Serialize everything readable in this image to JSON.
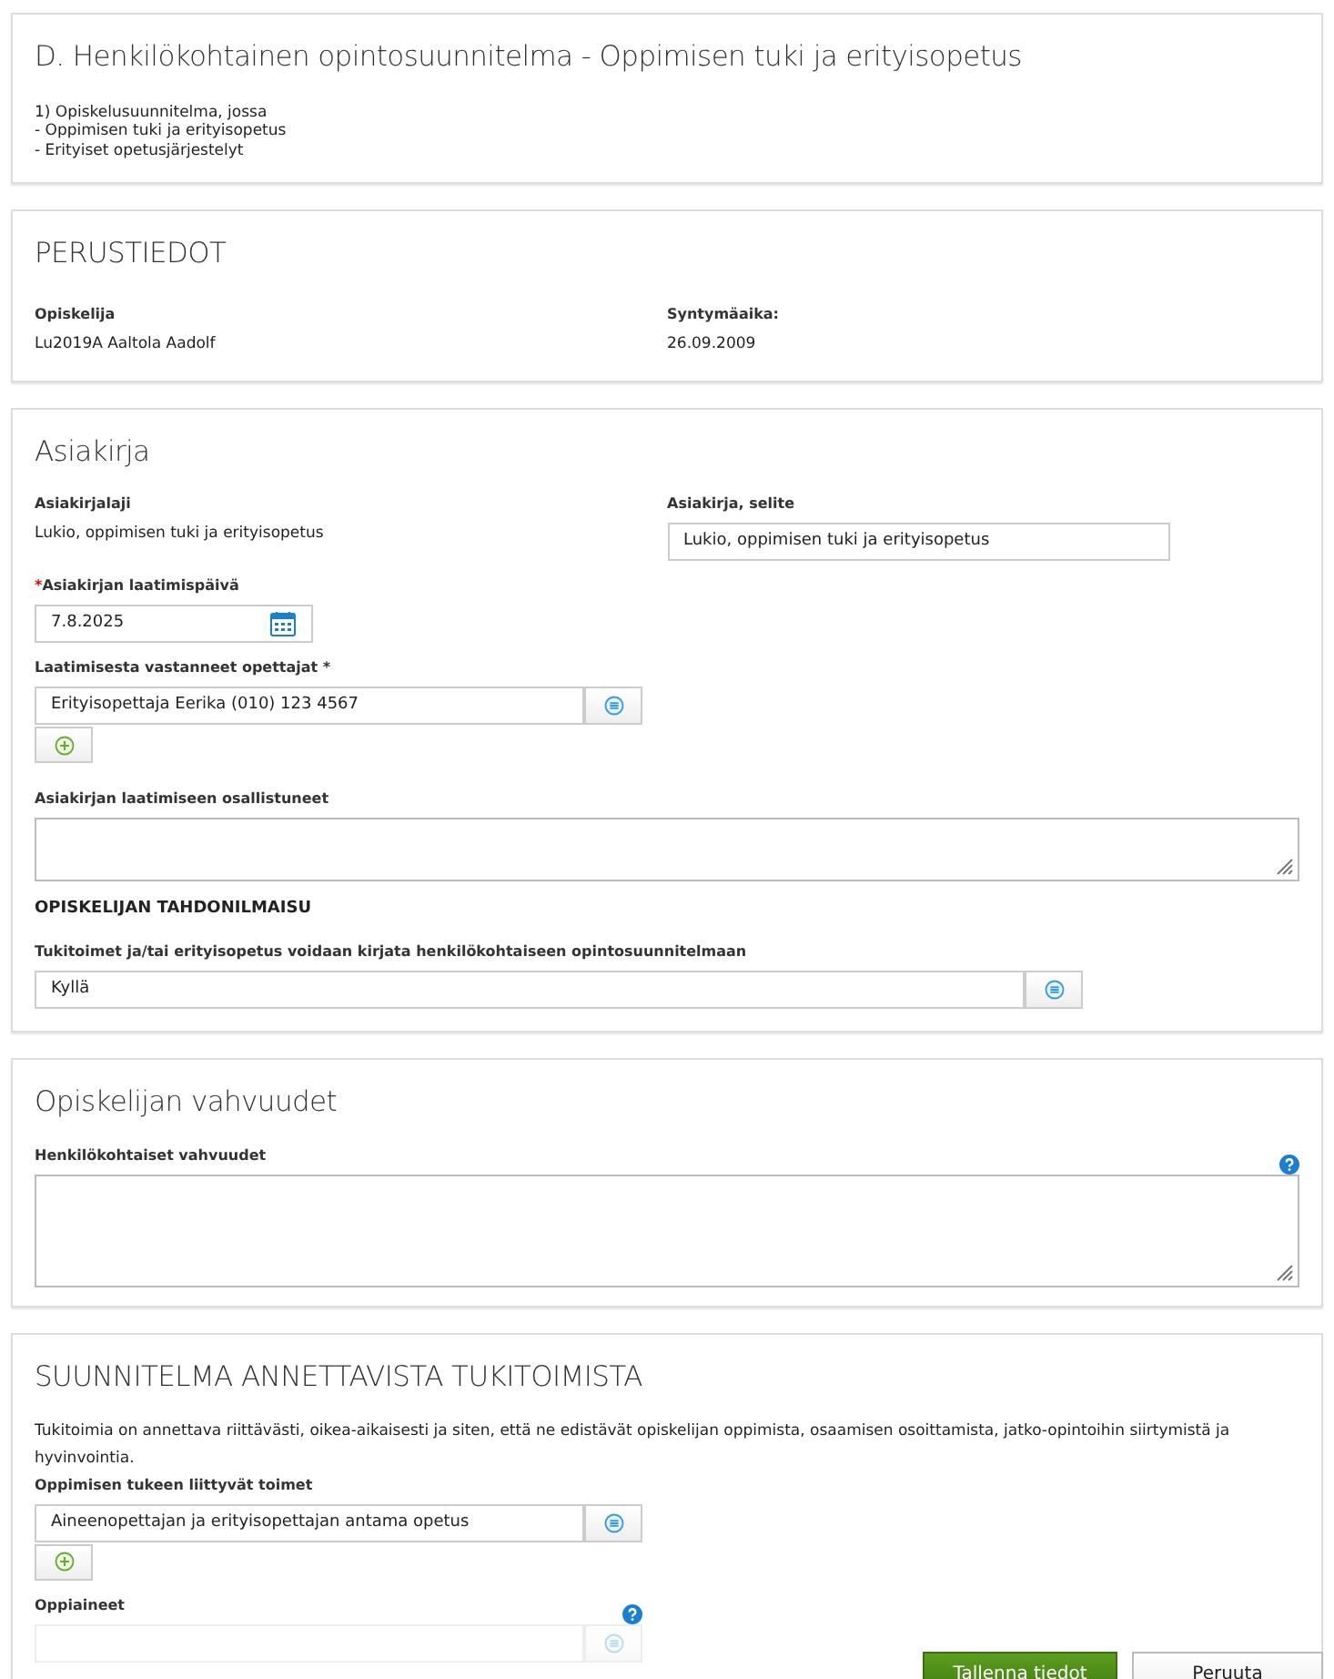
{
  "header": {
    "title": "D. Henkilökohtainen opintosuunnitelma - Oppimisen tuki ja erityisopetus",
    "lines": [
      "1) Opiskelusuunnitelma, jossa",
      "- Oppimisen tuki ja erityisopetus",
      "- Erityiset opetusjärjestelyt"
    ]
  },
  "basic_info": {
    "title": "PERUSTIEDOT",
    "fields": [
      {
        "label": "Opiskelija",
        "value": "Lu2019A Aaltola Aadolf"
      },
      {
        "label": "Syntymäaika:",
        "value": "26.09.2009"
      }
    ]
  },
  "document": {
    "title": "Asiakirja",
    "type_label": "Asiakirjalaji",
    "type_value": "Lukio, oppimisen tuki ja erityisopetus",
    "description_label": "Asiakirja, selite",
    "description_value": "Lukio, oppimisen tuki ja erityisopetus",
    "date_required_mark": "*",
    "date_label": "Asiakirjan laatimispäivä",
    "date_value": "7.8.2025",
    "teachers_label": "Laatimisesta vastanneet opettajat *",
    "teachers": [
      "Erityisopettaja Eerika (010) 123 4567"
    ],
    "participants_label": "Asiakirjan laatimiseen osallistuneet",
    "consent_heading": "OPISKELIJAN TAHDONILMAISU",
    "consent_label": "Tukitoimet ja/tai erityisopetus voidaan kirjata henkilökohtaiseen opintosuunnitelmaan",
    "consent_value": "Kyllä"
  },
  "strengths": {
    "title": "Opiskelijan vahvuudet",
    "field_label": "Henkilökohtaiset vahvuudet",
    "help": true
  },
  "support_plan": {
    "title": "SUUNNITELMA ANNETTAVISTA TUKITOIMISTA",
    "intro": "Tukitoimia on annettava riittävästi, oikea-aikaisesti ja siten, että ne edistävät opiskelijan oppimista, osaamisen osoittamista, jatko-opintoihin siirtymistä ja hyvinvointia.",
    "measures_label": "Oppimisen tukeen liittyvät toimet",
    "measures": [
      "Aineenopettajan ja erityisopettajan antama opetus"
    ],
    "subjects_label": "Oppiaineet",
    "subjects_help": true
  },
  "footer_buttons": [
    {
      "label": "Tallenna tiedot",
      "kind": "primary"
    },
    {
      "label": "Peruuta",
      "kind": "secondary"
    }
  ]
}
